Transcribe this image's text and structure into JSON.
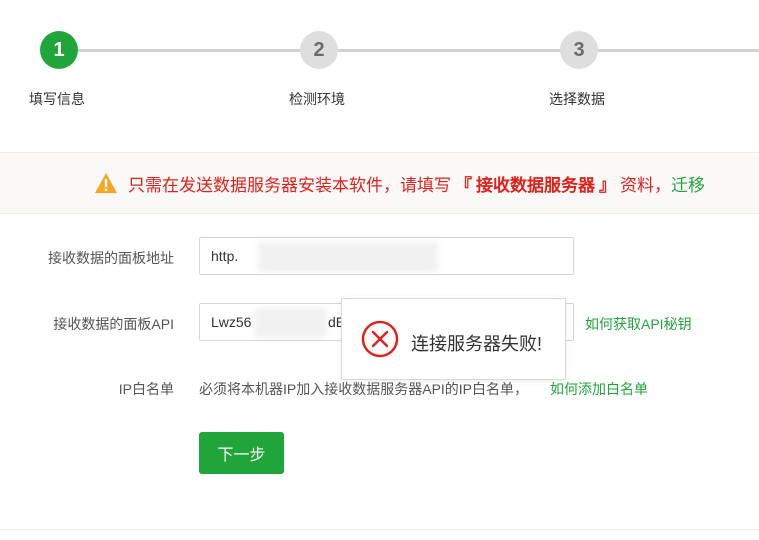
{
  "steps": [
    {
      "number": "1",
      "label": "填写信息",
      "active": true
    },
    {
      "number": "2",
      "label": "检测环境",
      "active": false
    },
    {
      "number": "3",
      "label": "选择数据",
      "active": false
    }
  ],
  "notice": {
    "icon": "warning-icon",
    "text_main": "只需在发送数据服务器安装本软件，请填写",
    "text_bracket_open": "『",
    "text_emphasis": "接收数据服务器",
    "text_bracket_close": "』",
    "text_tail": "资料，",
    "link_text": "迁移",
    "colors": {
      "red": "#e0211a",
      "green": "#20a53a"
    }
  },
  "form": {
    "panel_url": {
      "label": "接收数据的面板地址",
      "value": "http."
    },
    "panel_api": {
      "label": "接收数据的面板API",
      "value_prefix": "Lwz56",
      "value_fragment": "dE",
      "help_link": "如何获取API秘钥"
    },
    "ip_whitelist": {
      "label": "IP白名单",
      "text": "必须将本机器IP加入接收数据服务器API的IP白名单，",
      "help_link": "如何添加白名单"
    },
    "next_button": "下一步"
  },
  "toast": {
    "icon": "error-circle-icon",
    "message": "连接服务器失败!"
  },
  "colors": {
    "accent": "#20a53a",
    "error": "#e0211a"
  }
}
